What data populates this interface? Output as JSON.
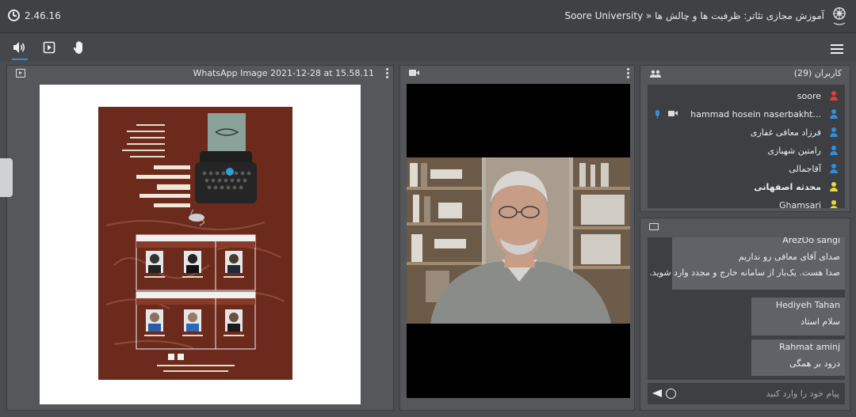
{
  "header": {
    "timer": "2.46.16",
    "title": "Soore University » آموزش مجازی تئاتر: ظرفیت ها و چالش ها"
  },
  "presentation": {
    "title": "WhatsApp Image 2021-12-28 at 15.58.11",
    "poster": {
      "heading": "سمپوزیوم آموزش مجازی تئاتر؛ ظرفیت‌ها و چالش‌ها",
      "session1": "جلسه اول",
      "session2": "جلسه دوم",
      "url": "https://ahvl.soore.ac.ir/rooms/theatre"
    }
  },
  "users": {
    "title": "کاربران (29)",
    "list": [
      {
        "name": "soore",
        "color": "#e83b3b",
        "bold": false
      },
      {
        "name": "...hammad hosein naserbakht",
        "color": "#2e8fe0",
        "bold": false
      },
      {
        "name": "فرزاد معافی غفاری",
        "color": "#2e8fe0",
        "bold": false
      },
      {
        "name": "رامتین شهبازی",
        "color": "#2e8fe0",
        "bold": false
      },
      {
        "name": "آقاجمالی",
        "color": "#2e8fe0",
        "bold": false
      },
      {
        "name": "محدثه اصفهانی",
        "color": "#e8d93b",
        "bold": true
      },
      {
        "name": "Ghamsari",
        "color": "#e8d93b",
        "bold": false
      }
    ]
  },
  "chat": {
    "messages": [
      {
        "sender": "ArezOo sangi",
        "lines": [
          "صدای آقای معافی رو نداریم",
          "صدا هست. یک‌بار از سامانه خارج و مجدد وارد شوید."
        ]
      },
      {
        "sender": "Hediyeh Tahan",
        "lines": [
          "سلام استاد"
        ]
      },
      {
        "sender": "Rahmat aminj",
        "lines": [
          "درود بر همگی"
        ]
      }
    ],
    "input_placeholder": "پیام خود را وارد کنید"
  }
}
